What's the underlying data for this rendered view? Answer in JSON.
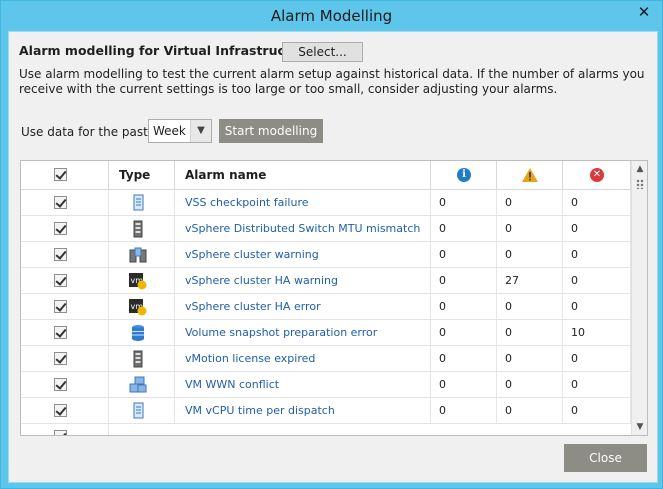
{
  "window": {
    "title": "Alarm Modelling",
    "close_glyph": "✕"
  },
  "header": {
    "heading": "Alarm modelling for Virtual Infrastructure",
    "select_button": "Select...",
    "description": "Use alarm modelling to test the current alarm setup against historical data. If the number of alarms you receive with the current settings is too large or too small, consider adjusting your alarms."
  },
  "controls": {
    "past_label": "Use data for the past",
    "period_value": "Week",
    "start_button": "Start modelling"
  },
  "grid": {
    "columns": {
      "type": "Type",
      "alarm_name": "Alarm name",
      "info_icon": "info-icon",
      "warning_icon": "warning-icon",
      "error_icon": "error-icon"
    },
    "rows": [
      {
        "checked": true,
        "icon": "vm-document-icon",
        "name": "VSS checkpoint failure",
        "info": "0",
        "warning": "0",
        "error": "0"
      },
      {
        "checked": true,
        "icon": "server-icon",
        "name": "vSphere Distributed Switch MTU mismatch",
        "info": "0",
        "warning": "0",
        "error": "0"
      },
      {
        "checked": true,
        "icon": "cluster-icon",
        "name": "vSphere cluster warning",
        "info": "0",
        "warning": "0",
        "error": "0"
      },
      {
        "checked": true,
        "icon": "vm-bell-icon",
        "name": "vSphere cluster HA warning",
        "info": "0",
        "warning": "27",
        "error": "0"
      },
      {
        "checked": true,
        "icon": "vm-bell-icon",
        "name": "vSphere cluster HA error",
        "info": "0",
        "warning": "0",
        "error": "0"
      },
      {
        "checked": true,
        "icon": "datastore-icon",
        "name": "Volume snapshot preparation error",
        "info": "0",
        "warning": "0",
        "error": "10"
      },
      {
        "checked": true,
        "icon": "server-icon",
        "name": "vMotion license expired",
        "info": "0",
        "warning": "0",
        "error": "0"
      },
      {
        "checked": true,
        "icon": "vm-network-icon",
        "name": "VM WWN conflict",
        "info": "0",
        "warning": "0",
        "error": "0"
      },
      {
        "checked": true,
        "icon": "vm-document-icon",
        "name": "VM vCPU time per dispatch",
        "info": "0",
        "warning": "0",
        "error": "0"
      }
    ]
  },
  "footer": {
    "close_button": "Close"
  },
  "colors": {
    "titlebar": "#5ec6ea",
    "link_text": "#1f5fa8",
    "button_gray": "#8d8d85",
    "info_blue": "#1f7cc7",
    "warning_amber": "#e8a317",
    "error_red": "#d93a3a"
  }
}
